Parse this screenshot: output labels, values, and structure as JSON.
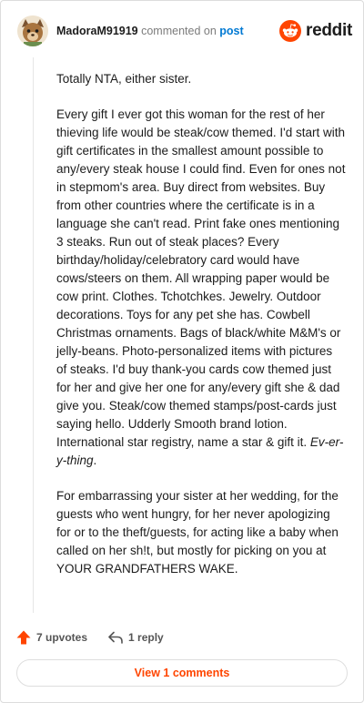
{
  "header": {
    "username": "MadoraM91919",
    "commented_on": "commented on",
    "post_link": "post",
    "brand": "reddit"
  },
  "comment": {
    "paragraph_1": "Totally NTA, either sister.",
    "paragraph_2": "Every gift I ever got this woman for the rest of her thieving life would be steak/cow themed. I'd start with gift certificates in the smallest amount possible to any/every steak house I could find. Even for ones not in stepmom's area. Buy direct from websites. Buy from other countries where the certificate is in a language she can't read. Print fake ones mentioning 3 steaks. Run out of steak places? Every birthday/holiday/celebratory card would have cows/steers on them. All wrapping paper would be cow print. Clothes. Tchotchkes. Jewelry. Outdoor decorations. Toys for any pet she has. Cowbell Christmas ornaments. Bags of black/white M&M's or jelly-beans. Photo-personalized items with pictures of steaks. I'd buy thank-you cards cow themed just for her and give her one for any/every gift she & dad give you. Steak/cow themed stamps/post-cards just saying hello. Udderly Smooth brand lotion. International star registry, name a star & gift it.",
    "paragraph_2_emphasis": "Ev-er-y-thing",
    "paragraph_2_end": ".",
    "paragraph_3": "For embarrassing your sister at her wedding, for the guests who went hungry, for her never apologizing for or to the theft/guests, for acting like a baby when called on her sh!t, but mostly for picking on you at YOUR GRANDFATHERS WAKE."
  },
  "footer": {
    "upvotes_label": "7 upvotes",
    "reply_label": "1 reply",
    "view_comments_label": "View 1 comments"
  },
  "colors": {
    "accent": "#ff4500",
    "link": "#0079d3",
    "muted": "#7c7c7c"
  },
  "icons": [
    "avatar-icon",
    "reddit-logo-icon",
    "upvote-arrow-icon",
    "reply-arrow-icon"
  ]
}
